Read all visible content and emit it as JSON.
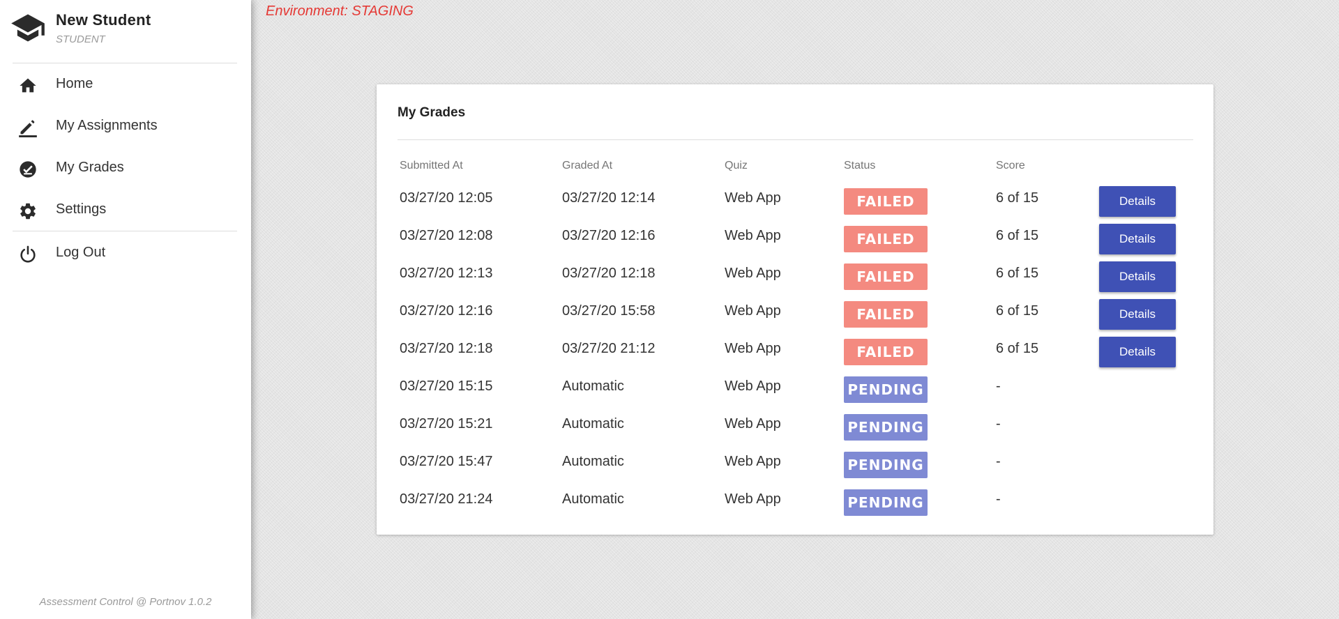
{
  "profile": {
    "name": "New Student",
    "role": "STUDENT",
    "icon": "graduation-cap-icon"
  },
  "nav": {
    "items": [
      {
        "label": "Home",
        "icon": "home-icon"
      },
      {
        "label": "My Assignments",
        "icon": "edit-icon"
      },
      {
        "label": "My Grades",
        "icon": "grade-check-icon"
      },
      {
        "label": "Settings",
        "icon": "gear-icon"
      },
      {
        "label": "Log Out",
        "icon": "power-icon"
      }
    ]
  },
  "footer": "Assessment Control @ Portnov 1.0.2",
  "environment": "Environment: STAGING",
  "grades": {
    "title": "My Grades",
    "headers": [
      "Submitted At",
      "Graded At",
      "Quiz",
      "Status",
      "Score"
    ],
    "rows": [
      {
        "submitted": "03/27/20 12:05",
        "graded": "03/27/20 12:14",
        "quiz": "Web App",
        "status": "FAILED",
        "score": "6 of 15",
        "action": "Details"
      },
      {
        "submitted": "03/27/20 12:08",
        "graded": "03/27/20 12:16",
        "quiz": "Web App",
        "status": "FAILED",
        "score": "6 of 15",
        "action": "Details"
      },
      {
        "submitted": "03/27/20 12:13",
        "graded": "03/27/20 12:18",
        "quiz": "Web App",
        "status": "FAILED",
        "score": "6 of 15",
        "action": "Details"
      },
      {
        "submitted": "03/27/20 12:16",
        "graded": "03/27/20 15:58",
        "quiz": "Web App",
        "status": "FAILED",
        "score": "6 of 15",
        "action": "Details"
      },
      {
        "submitted": "03/27/20 12:18",
        "graded": "03/27/20 21:12",
        "quiz": "Web App",
        "status": "FAILED",
        "score": "6 of 15",
        "action": "Details"
      },
      {
        "submitted": "03/27/20 15:15",
        "graded": "Automatic",
        "quiz": "Web App",
        "status": "PENDING",
        "score": "-",
        "action": ""
      },
      {
        "submitted": "03/27/20 15:21",
        "graded": "Automatic",
        "quiz": "Web App",
        "status": "PENDING",
        "score": "-",
        "action": ""
      },
      {
        "submitted": "03/27/20 15:47",
        "graded": "Automatic",
        "quiz": "Web App",
        "status": "PENDING",
        "score": "-",
        "action": ""
      },
      {
        "submitted": "03/27/20 21:24",
        "graded": "Automatic",
        "quiz": "Web App",
        "status": "PENDING",
        "score": "-",
        "action": ""
      }
    ]
  },
  "colors": {
    "failed": "#f48a80",
    "pending": "#7f8ad4",
    "primary": "#3f51b5",
    "environment": "#e53935"
  }
}
